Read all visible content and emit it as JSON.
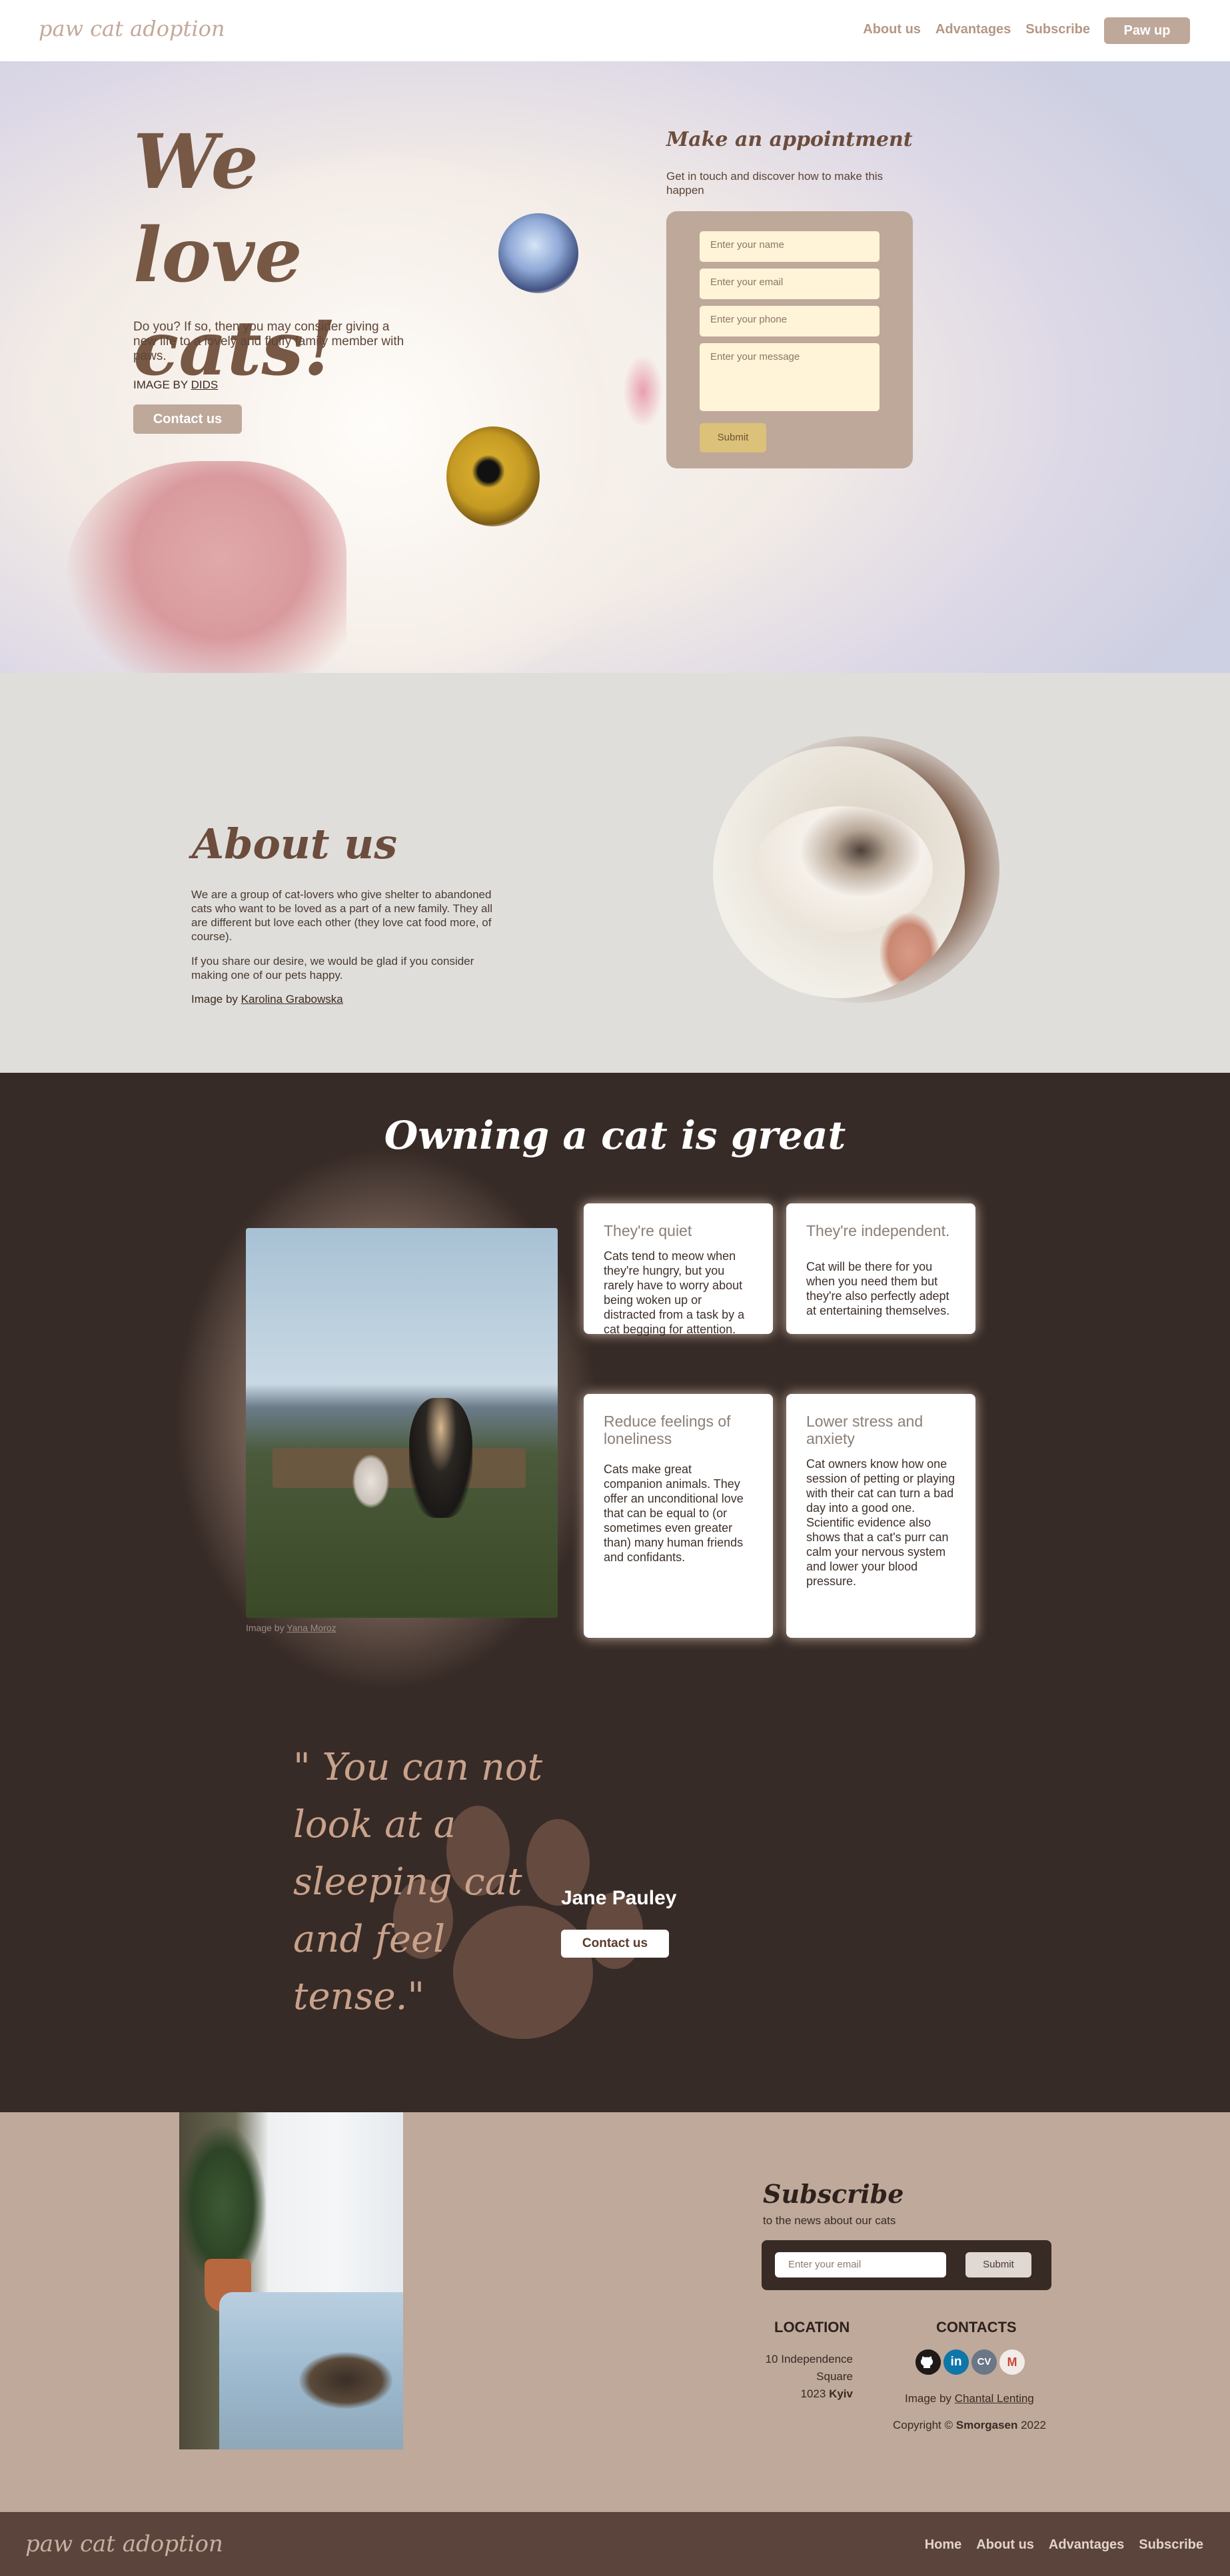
{
  "header": {
    "logo": "paw cat adoption",
    "nav": [
      "About us",
      "Advantages",
      "Subscribe"
    ],
    "cta": "Paw up"
  },
  "hero": {
    "title": "We love cats!",
    "text": "Do you? If so, then you may consider giving a new life to a lovely and fluffy family member with paws.",
    "credit_prefix": "IMAGE BY",
    "credit_name": "DIDS",
    "contact_button": "Contact us"
  },
  "appointment": {
    "title": "Make an appointment",
    "subtitle": "Get in touch and discover how to make this happen",
    "name_placeholder": "Enter your name",
    "email_placeholder": "Enter your email",
    "phone_placeholder": "Enter your phone",
    "message_placeholder": "Enter your message",
    "submit": "Submit"
  },
  "about": {
    "title": "About us",
    "p1": "We are a group of cat-lovers who give shelter to abandoned cats who want to be loved as a part of a new family. They all are different but love each other (they love cat food more, of course).",
    "p2": "If you share our desire, we would be glad if you consider making one of our pets happy.",
    "credit_prefix": "Image by",
    "credit_name": "Karolina Grabowska"
  },
  "owning": {
    "title": "Owning a cat is great",
    "credit_prefix": "Image by",
    "credit_name": "Yana Moroz",
    "cards": [
      {
        "title": "They're quiet",
        "text": "Cats tend to meow when they're hungry, but you rarely have to worry about being woken up or distracted from a task by a cat begging for attention."
      },
      {
        "title": "They're independent.",
        "text": "Cat will be there for you when you need them but they're also perfectly adept at entertaining themselves."
      },
      {
        "title": "Reduce feelings of loneliness",
        "text": "Cats make great companion animals. They offer an unconditional love that can be equal to (or sometimes even greater than) many human friends and confidants."
      },
      {
        "title": "Lower stress and anxiety",
        "text": "Cat owners know how one session of petting or playing with their cat can turn a bad day into a good one. Scientific evidence also shows that a cat's purr can calm your nervous system and lower your blood pressure."
      }
    ]
  },
  "quote": {
    "text": "\" You can not look at a sleeping cat and feel tense.\"",
    "author": "Jane Pauley",
    "contact_button": "Contact us"
  },
  "subscribe": {
    "title": "Subscribe",
    "subtitle": "to the news about our cats",
    "email_placeholder": "Enter your email",
    "submit": "Submit"
  },
  "location": {
    "title": "LOCATION",
    "line1": "10 Independence Square",
    "line2_prefix": "1023",
    "line2_city": "Kyiv"
  },
  "contacts": {
    "title": "CONTACTS",
    "icons": [
      "github-icon",
      "linkedin-icon",
      "cv-icon",
      "gmail-icon"
    ],
    "linkedin_glyph": "in",
    "cv_glyph": "CV",
    "gmail_glyph": "M",
    "credit_prefix": "Image by",
    "credit_name": "Chantal Lenting",
    "copyright_prefix": "Copyright ©",
    "copyright_name": "Smorgasen",
    "copyright_year": "2022"
  },
  "footer": {
    "logo": "paw cat adoption",
    "nav": [
      "Home",
      "About us",
      "Advantages",
      "Subscribe"
    ]
  },
  "colors": {
    "accent": "#bea89a",
    "dark": "#372b27",
    "brown": "#6c4c3c",
    "input_bg": "#fff4d7",
    "submit": "#dcc17a"
  }
}
